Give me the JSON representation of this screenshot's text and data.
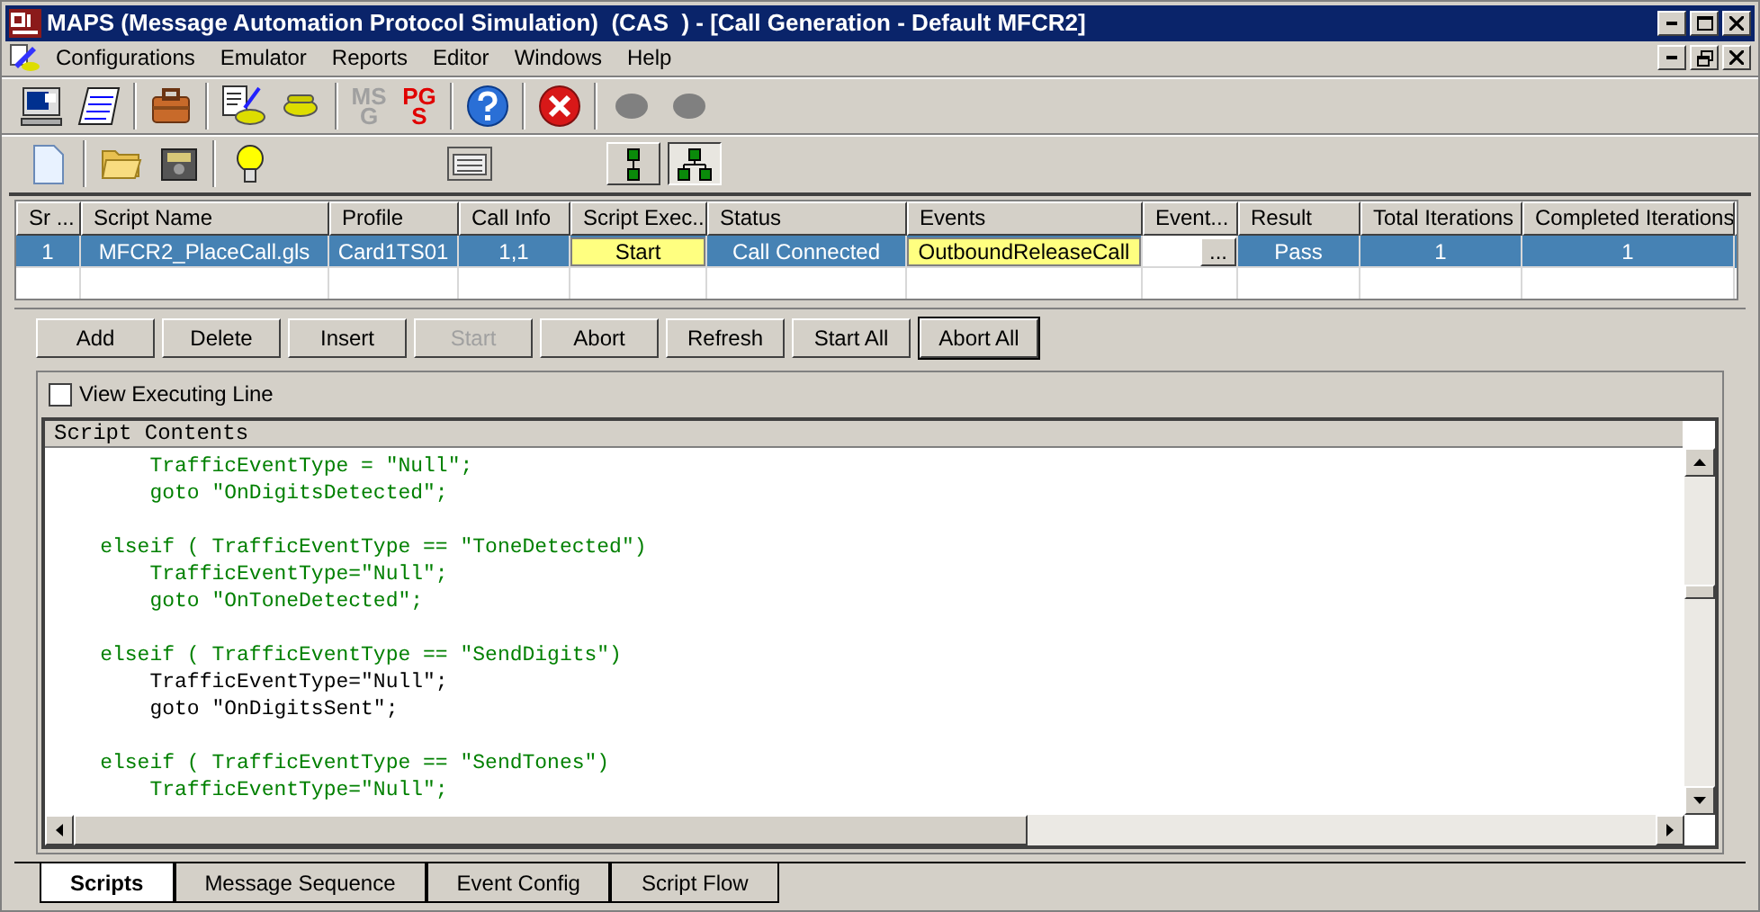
{
  "window": {
    "title": "MAPS (Message Automation Protocol Simulation)  (CAS  ) - [Call Generation - Default MFCR2]"
  },
  "menu": [
    "Configurations",
    "Emulator",
    "Reports",
    "Editor",
    "Windows",
    "Help"
  ],
  "toolbar": [
    [
      {
        "kind": "monitor"
      },
      {
        "kind": "notepad"
      }
    ],
    [
      {
        "kind": "briefcase"
      }
    ],
    [
      {
        "kind": "edit-phone"
      },
      {
        "kind": "phone"
      }
    ],
    [
      {
        "kind": "text",
        "lines": [
          "MS",
          "G"
        ],
        "disabled": true
      },
      {
        "kind": "text",
        "lines": [
          "PG",
          "S"
        ],
        "disabled": false
      }
    ],
    [
      {
        "kind": "help"
      }
    ],
    [
      {
        "kind": "stop"
      }
    ],
    [
      {
        "kind": "dot"
      },
      {
        "kind": "dot"
      }
    ]
  ],
  "toolbar2": [
    [
      {
        "kind": "new"
      }
    ],
    [
      {
        "kind": "folder"
      },
      {
        "kind": "safe"
      }
    ],
    [
      {
        "kind": "bulb"
      },
      {
        "kind": "panel"
      },
      {
        "kind": "vertical-tree",
        "selected": false
      },
      {
        "kind": "tree",
        "selected": true
      }
    ]
  ],
  "table": {
    "columns": [
      "Sr ...",
      "Script Name",
      "Profile",
      "Call Info",
      "Script Exec...",
      "Status",
      "Events",
      "Event...",
      "Result",
      "Total Iterations",
      "Completed Iterations"
    ],
    "rows": [
      {
        "selected": true,
        "cells": [
          {
            "text": "1"
          },
          {
            "text": "MFCR2_PlaceCall.gls"
          },
          {
            "text": "Card1TS01"
          },
          {
            "text": "1,1"
          },
          {
            "text": "Start",
            "kind": "highlight"
          },
          {
            "text": "Call Connected"
          },
          {
            "text": "OutboundReleaseCall",
            "kind": "highlight"
          },
          {
            "text": "...",
            "kind": "ellipsis"
          },
          {
            "text": "Pass"
          },
          {
            "text": "1"
          },
          {
            "text": "1"
          }
        ]
      }
    ]
  },
  "buttons": [
    {
      "label": "Add",
      "disabled": false,
      "default": false
    },
    {
      "label": "Delete",
      "disabled": false,
      "default": false
    },
    {
      "label": "Insert",
      "disabled": false,
      "default": false
    },
    {
      "label": "Start",
      "disabled": true,
      "default": false
    },
    {
      "label": "Abort",
      "disabled": false,
      "default": false
    },
    {
      "label": "Refresh",
      "disabled": false,
      "default": false
    },
    {
      "label": "Start All",
      "disabled": false,
      "default": false
    },
    {
      "label": "Abort All",
      "disabled": false,
      "default": true
    }
  ],
  "view_executing_line": {
    "label": "View Executing Line",
    "checked": false
  },
  "editor": {
    "title": "Script Contents",
    "blocks": [
      [
        {
          "text": "        TrafficEventType = \"Null\";",
          "color": "#008000"
        },
        {
          "text": "        goto \"OnDigitsDetected\";",
          "color": "#008000"
        }
      ],
      [
        {
          "text": "    elseif ( TrafficEventType == \"ToneDetected\")",
          "color": "#008000"
        },
        {
          "text": "        TrafficEventType=\"Null\";",
          "color": "#008000"
        },
        {
          "text": "        goto \"OnToneDetected\";",
          "color": "#008000"
        }
      ],
      [
        {
          "text": "    elseif ( TrafficEventType == \"SendDigits\")",
          "color": "#008000"
        },
        {
          "text": "        TrafficEventType=\"Null\";",
          "color": "#000000"
        },
        {
          "text": "        goto \"OnDigitsSent\";",
          "color": "#000000"
        }
      ],
      [
        {
          "text": "    elseif ( TrafficEventType == \"SendTones\")",
          "color": "#008000"
        },
        {
          "text": "        TrafficEventType=\"Null\";",
          "color": "#008000"
        }
      ]
    ]
  },
  "tabs": [
    {
      "label": "Scripts",
      "selected": true
    },
    {
      "label": "Message Sequence",
      "selected": false
    },
    {
      "label": "Event Config",
      "selected": false
    },
    {
      "label": "Script Flow",
      "selected": false
    }
  ]
}
